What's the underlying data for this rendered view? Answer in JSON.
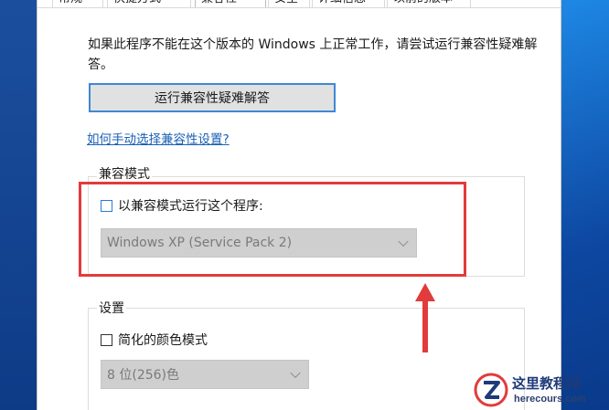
{
  "tabs": [
    {
      "label": "常规"
    },
    {
      "label": "快捷方式"
    },
    {
      "label": "兼容性"
    },
    {
      "label": "安全"
    },
    {
      "label": "详细信息"
    },
    {
      "label": "以前的版本"
    }
  ],
  "intro_text": "如果此程序不能在这个版本的 Windows 上正常工作，请尝试运行兼容性疑难解答。",
  "troubleshoot_button": "运行兼容性疑难解答",
  "help_link": "如何手动选择兼容性设置?",
  "compat_group": {
    "legend": "兼容模式",
    "checkbox_label": "以兼容模式运行这个程序:",
    "checked": false,
    "selected_os": "Windows XP (Service Pack 2)"
  },
  "settings_group": {
    "legend": "设置",
    "reduced_color_label": "简化的颜色模式",
    "reduced_color_checked": false,
    "color_depth": "8 位(256)色"
  },
  "watermark": {
    "name": "这里教程网",
    "url": "herecours.com"
  },
  "colors": {
    "highlight": "#e23b3b",
    "link": "#1a5fb4",
    "accent_border": "#3f87d6"
  }
}
